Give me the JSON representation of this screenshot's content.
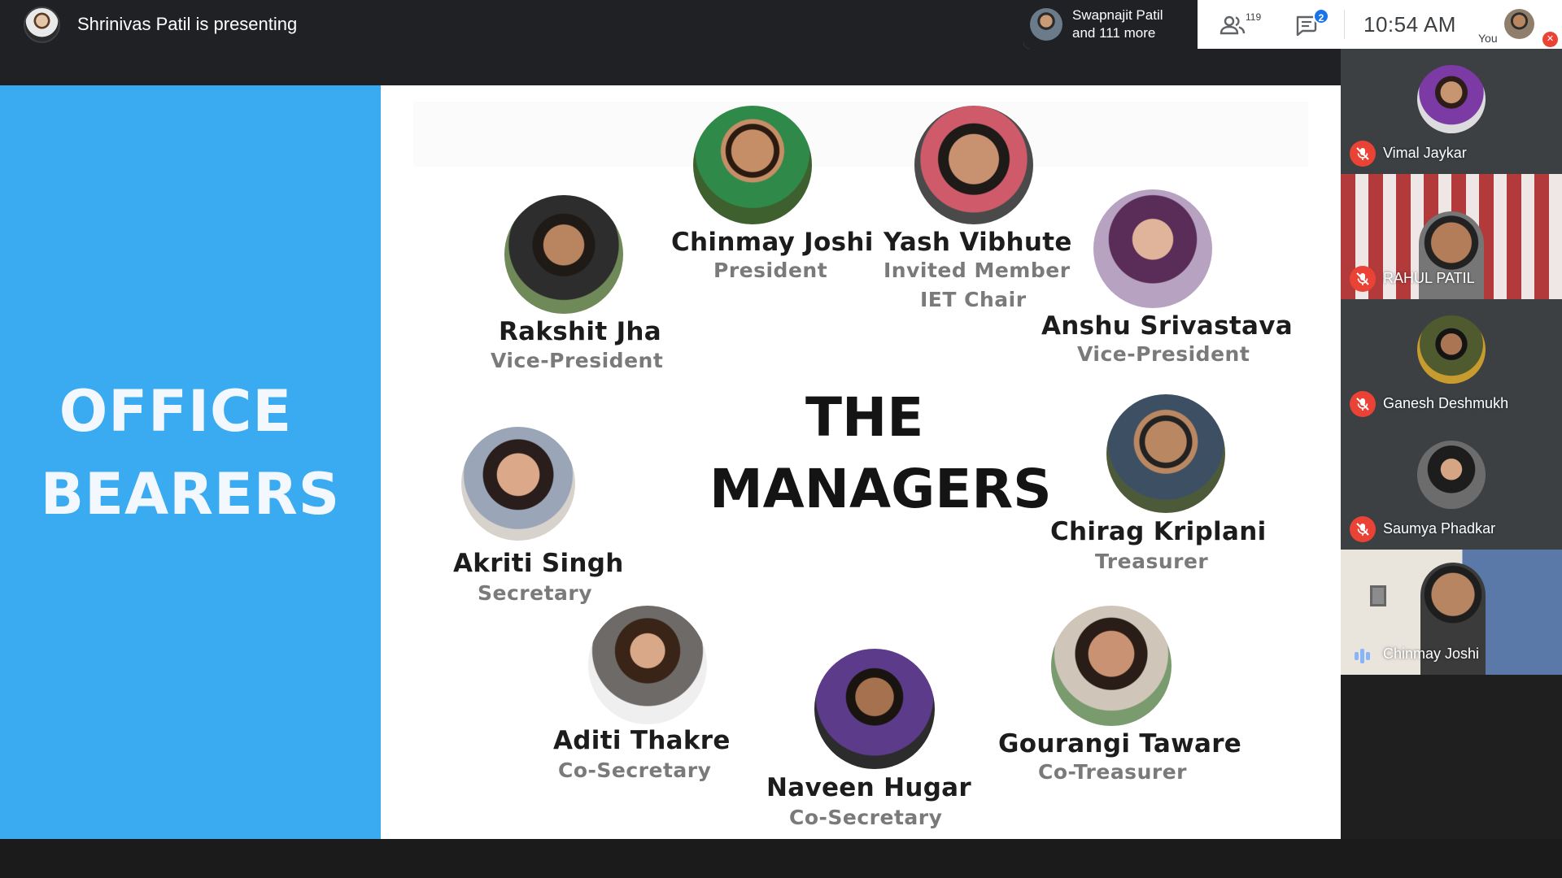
{
  "meeting": {
    "presenter_text": "Shrinivas Patil is presenting",
    "recent_join": {
      "line1": "Swapnajit Patil",
      "line2": "and 111 more"
    },
    "people_count": "119",
    "chat_badge": "2",
    "clock": "10:54  AM",
    "you_label": "You"
  },
  "slide": {
    "left_title_line1": "OFFICE",
    "left_title_line2": "BEARERS",
    "center_title_line1": "THE",
    "center_title_line2": "MANAGERS",
    "members": [
      {
        "name": "Chinmay Joshi",
        "role": "President"
      },
      {
        "name": "Yash Vibhute",
        "role": "Invited Member",
        "role2": "IET Chair"
      },
      {
        "name": "Rakshit Jha",
        "role": "Vice-President"
      },
      {
        "name": "Anshu Srivastava",
        "role": "Vice-President"
      },
      {
        "name": "Akriti Singh",
        "role": "Secretary"
      },
      {
        "name": "Chirag Kriplani",
        "role": "Treasurer"
      },
      {
        "name": "Aditi Thakre",
        "role": "Co-Secretary"
      },
      {
        "name": "Naveen Hugar",
        "role": "Co-Secretary"
      },
      {
        "name": "Gourangi Taware",
        "role": "Co-Treasurer"
      }
    ],
    "colors": {
      "left_panel": "#3aaaf1",
      "title_dark": "#141414",
      "role_grey": "#7a7a7a"
    }
  },
  "participants": [
    {
      "name": "Vimal Jaykar",
      "muted": true
    },
    {
      "name": "RAHUL PATIL",
      "muted": true
    },
    {
      "name": "Ganesh Deshmukh",
      "muted": true
    },
    {
      "name": "Saumya Phadkar",
      "muted": true
    },
    {
      "name": "Chinmay Joshi",
      "muted": false,
      "speaking": true
    }
  ],
  "icons": {
    "people": "people-icon",
    "chat": "chat-icon",
    "mic_off": "mic-off-icon",
    "speaking": "audio-level-icon"
  }
}
